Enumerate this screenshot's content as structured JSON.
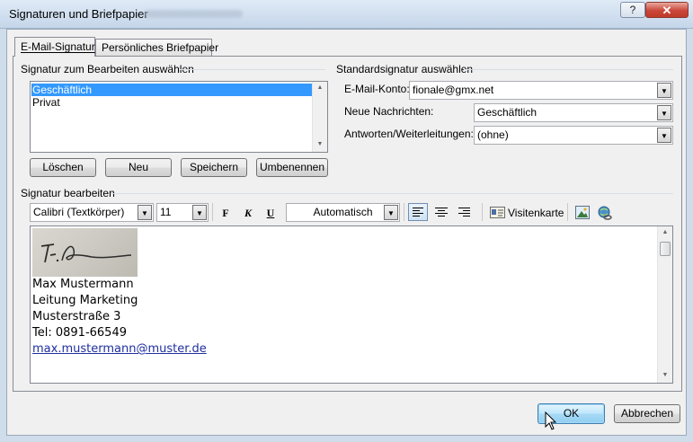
{
  "window": {
    "title": "Signaturen und Briefpapier",
    "help_label": "?",
    "close_label": "✕"
  },
  "tabs": [
    {
      "label": "E-Mail-Signatur",
      "active": true
    },
    {
      "label": "Persönliches Briefpapier",
      "active": false
    }
  ],
  "select_signature": {
    "group_label": "Signatur zum Bearbeiten auswählen",
    "items": [
      {
        "label": "Geschäftlich",
        "selected": true
      },
      {
        "label": "Privat",
        "selected": false
      }
    ],
    "buttons": {
      "delete": "Löschen",
      "new": "Neu",
      "save": "Speichern",
      "rename": "Umbenennen"
    }
  },
  "default_signature": {
    "group_label": "Standardsignatur auswählen",
    "account_label": "E-Mail-Konto:",
    "account_value": "fionale@gmx.net",
    "new_messages_label": "Neue Nachrichten:",
    "new_messages_value": "Geschäftlich",
    "replies_label": "Antworten/Weiterleitungen:",
    "replies_value": "(ohne)"
  },
  "edit_signature": {
    "group_label": "Signatur bearbeiten",
    "toolbar": {
      "font_family": "Calibri (Textkörper)",
      "font_size": "11",
      "bold": "F",
      "italic": "K",
      "underline": "U",
      "color": "Automatisch",
      "business_card": "Visitenkarte"
    },
    "content": {
      "lines": [
        "Max Mustermann",
        "Leitung Marketing",
        "Musterstraße 3",
        "Tel: 0891-66549"
      ],
      "email": "max.mustermann@muster.de"
    }
  },
  "footer": {
    "ok": "OK",
    "cancel": "Abbrechen"
  },
  "colors": {
    "selection": "#3399ff",
    "link": "#1f2f9f",
    "group_label": "#000000"
  }
}
